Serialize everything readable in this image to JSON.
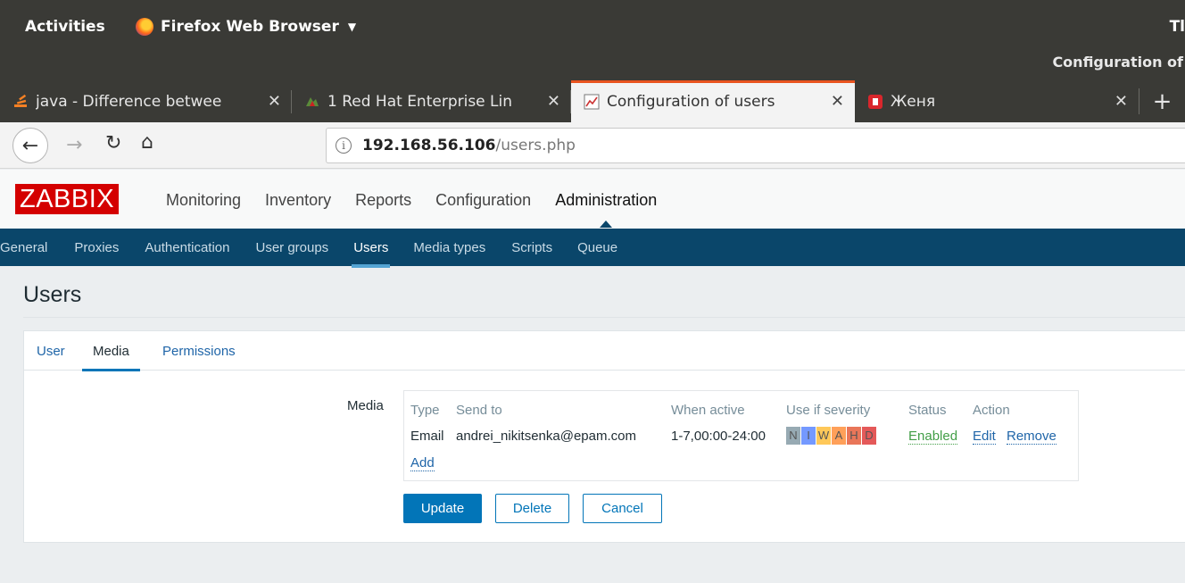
{
  "system_bar": {
    "activities": "Activities",
    "app_menu": "Firefox Web Browser",
    "clock": "Tl"
  },
  "window": {
    "title": "Configuration of"
  },
  "tabs": [
    {
      "label": "java - Difference betwee",
      "close": "✕"
    },
    {
      "label": "1 Red Hat Enterprise Lin",
      "close": "✕"
    },
    {
      "label": "Configuration of users",
      "close": "✕"
    },
    {
      "label": "Женя",
      "close": "✕"
    }
  ],
  "new_tab": "+",
  "address_bar": {
    "host": "192.168.56.106",
    "path": "/users.php"
  },
  "zabbix": {
    "logo": "ZABBIX",
    "main_menu": [
      "Monitoring",
      "Inventory",
      "Reports",
      "Configuration",
      "Administration"
    ],
    "main_menu_selected": "Administration",
    "sub_menu": [
      "General",
      "Proxies",
      "Authentication",
      "User groups",
      "Users",
      "Media types",
      "Scripts",
      "Queue"
    ],
    "sub_menu_selected": "Users"
  },
  "page": {
    "title": "Users",
    "tabs": [
      "User",
      "Media",
      "Permissions"
    ],
    "selected_tab": "Media",
    "field_label": "Media",
    "media_table": {
      "headers": [
        "Type",
        "Send to",
        "When active",
        "Use if severity",
        "Status",
        "Action"
      ],
      "row": {
        "type": "Email",
        "send_to": "andrei_nikitsenka@epam.com",
        "when_active": "1-7,00:00-24:00",
        "severity": [
          {
            "letter": "N",
            "color": "#97aab3"
          },
          {
            "letter": "I",
            "color": "#7499ff"
          },
          {
            "letter": "W",
            "color": "#ffc859"
          },
          {
            "letter": "A",
            "color": "#ffa059"
          },
          {
            "letter": "H",
            "color": "#e97659"
          },
          {
            "letter": "D",
            "color": "#e45959"
          }
        ],
        "status": "Enabled",
        "action_edit": "Edit",
        "action_remove": "Remove"
      },
      "add_link": "Add"
    },
    "buttons": {
      "update": "Update",
      "delete": "Delete",
      "cancel": "Cancel"
    }
  }
}
